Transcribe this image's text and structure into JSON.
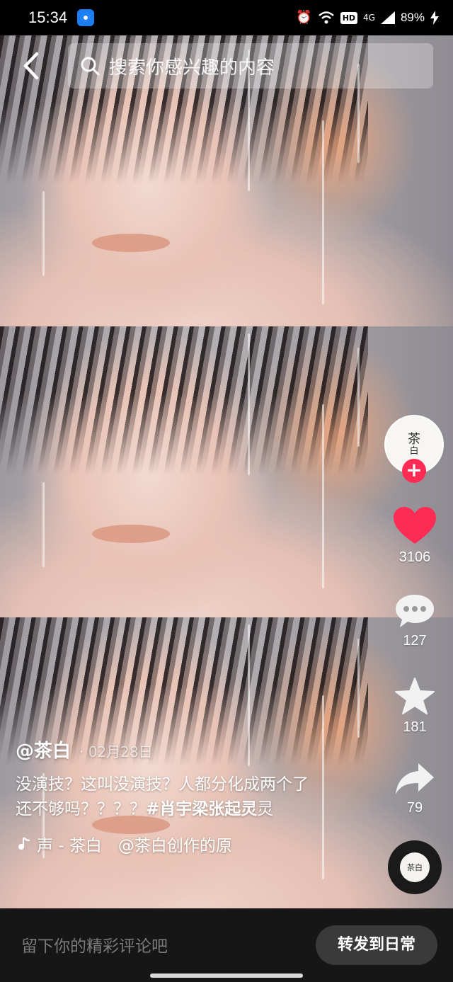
{
  "status_bar": {
    "time": "15:34",
    "network": "4G",
    "battery": "89%",
    "hd": "HD"
  },
  "search": {
    "placeholder": "搜索你感兴趣的内容"
  },
  "rail": {
    "avatar_text_top": "茶",
    "avatar_text_bottom": "白",
    "likes": "3106",
    "comments": "127",
    "favorites": "181",
    "shares": "79",
    "disc_text": "茶白"
  },
  "post": {
    "author": "@茶白",
    "date": "· 02月28日",
    "desc_text": "没演技？这叫没演技？人都分化成两个了还不够吗？？？？",
    "hashtag": "#肖宇梁张起灵",
    "music": "声 - 茶白　@茶白创作的原"
  },
  "bottom": {
    "comment_placeholder": "留下你的精彩评论吧",
    "share_label": "转发到日常"
  },
  "colors": {
    "accent": "#fe2c55",
    "like": "#fe2c55"
  }
}
